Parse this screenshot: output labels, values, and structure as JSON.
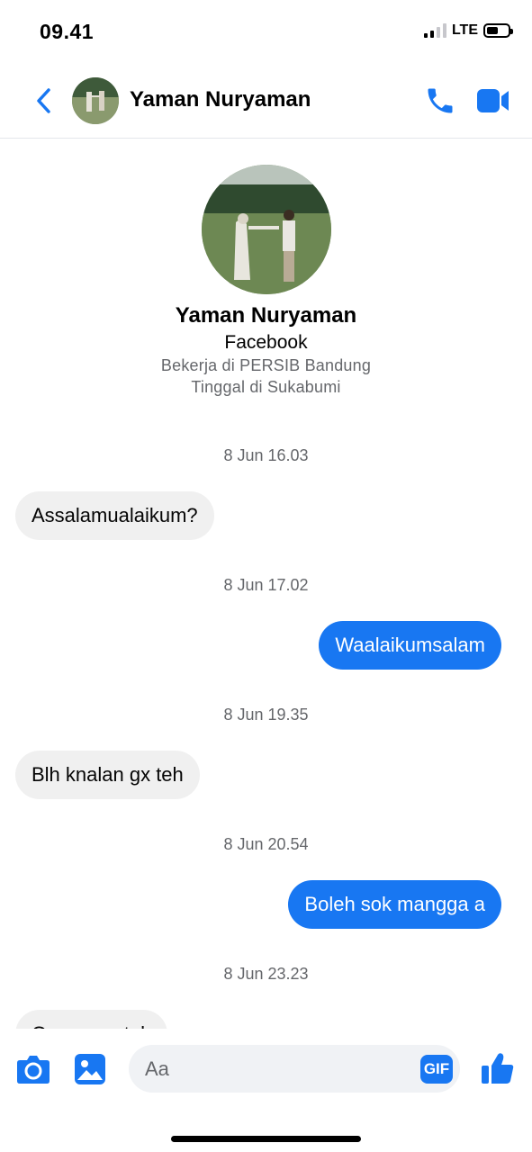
{
  "status_bar": {
    "time": "09.41",
    "network": "LTE"
  },
  "header": {
    "contact_name": "Yaman Nuryaman"
  },
  "profile": {
    "name": "Yaman Nuryaman",
    "source": "Facebook",
    "work": "Bekerja di PERSIB Bandung",
    "location": "Tinggal di Sukabumi"
  },
  "messages": [
    {
      "timestamp": "8 Jun 16.03",
      "direction": "incoming",
      "text": "Assalamualaikum?"
    },
    {
      "timestamp": "8 Jun 17.02",
      "direction": "outgoing",
      "text": "Waalaikumsalam"
    },
    {
      "timestamp": "8 Jun 19.35",
      "direction": "incoming",
      "text": "Blh knalan gx teh"
    },
    {
      "timestamp": "8 Jun 20.54",
      "direction": "outgoing",
      "text": "Boleh sok mangga a"
    },
    {
      "timestamp": "8 Jun 23.23",
      "direction": "incoming",
      "text": "Oaaaaaaatah"
    }
  ],
  "composer": {
    "placeholder": "Aa",
    "gif_label": "GIF"
  },
  "colors": {
    "accent": "#1877f2",
    "incoming_bubble": "#f0f0f0",
    "muted_text": "#65676b"
  },
  "icons": [
    "back-chevron-icon",
    "phone-icon",
    "video-camera-icon",
    "camera-icon",
    "image-icon",
    "thumbs-up-icon"
  ]
}
